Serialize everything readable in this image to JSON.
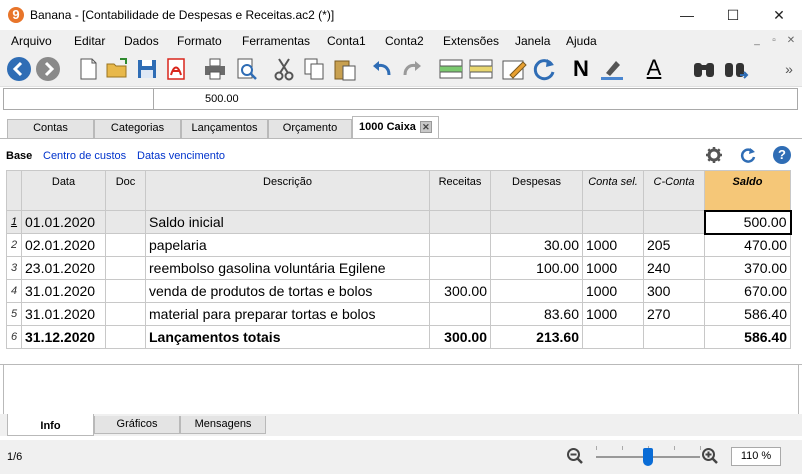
{
  "window": {
    "app_logo": "9",
    "title": "Banana - [Contabilidade de Despesas e Receitas.ac2 (*)]",
    "minimize_label": "—",
    "maximize_label": "☐",
    "close_label": "✕"
  },
  "menu": {
    "items": [
      "Arquivo",
      "Editar",
      "Dados",
      "Formato",
      "Ferramentas",
      "Conta1",
      "Conta2",
      "Extensões",
      "Janela",
      "Ajuda"
    ],
    "mdi": {
      "minimize": "_",
      "restore": "▫",
      "close": "✕"
    }
  },
  "toolbar": {
    "icons": [
      "back-icon",
      "forward-icon",
      "new-file-icon",
      "open-folder-icon",
      "save-icon",
      "pdf-icon",
      "print-icon",
      "print-preview-icon",
      "cut-icon",
      "copy-icon",
      "paste-icon",
      "undo-icon",
      "redo-icon",
      "add-row-icon",
      "insert-row-icon",
      "edit-icon",
      "recalculate-icon",
      "bold-icon",
      "highlighter-icon",
      "font-color-icon",
      "search-icon",
      "find-next-icon"
    ],
    "bold_glyph": "N",
    "font_color_glyph": "A",
    "overflow_glyph": "»",
    "colors": {
      "back_forward": "#2f6db5",
      "pdf": "#d9261c",
      "highlight_bar": "#4a86d0",
      "font_color_bar": "#000000"
    }
  },
  "formula_bar": {
    "value": "500.00"
  },
  "tabs": {
    "items": [
      "Contas",
      "Categorias",
      "Lançamentos",
      "Orçamento"
    ],
    "active": "1000 Caixa",
    "active_close": "✕"
  },
  "views": {
    "base": "Base",
    "links": [
      "Centro de custos",
      "Datas vencimento"
    ],
    "right_icons": [
      "gear-icon",
      "refresh-icon",
      "help-icon"
    ],
    "help_glyph": "?"
  },
  "table": {
    "columns": [
      "Data",
      "Doc",
      "Descrição",
      "Receitas",
      "Despesas",
      "Conta sel.",
      "C-Conta",
      "Saldo"
    ],
    "rows": [
      {
        "n": "1",
        "data": "01.01.2020",
        "doc": "",
        "desc": "Saldo inicial",
        "receitas": "",
        "despesas": "",
        "conta": "",
        "cconta": "",
        "saldo": "500.00"
      },
      {
        "n": "2",
        "data": "02.01.2020",
        "doc": "",
        "desc": "papelaria",
        "receitas": "",
        "despesas": "30.00",
        "conta": "1000",
        "cconta": "205",
        "saldo": "470.00"
      },
      {
        "n": "3",
        "data": "23.01.2020",
        "doc": "",
        "desc": "reembolso gasolina voluntária Egilene",
        "receitas": "",
        "despesas": "100.00",
        "conta": "1000",
        "cconta": "240",
        "saldo": "370.00"
      },
      {
        "n": "4",
        "data": "31.01.2020",
        "doc": "",
        "desc": "venda de produtos de tortas e bolos",
        "receitas": "300.00",
        "despesas": "",
        "conta": "1000",
        "cconta": "300",
        "saldo": "670.00"
      },
      {
        "n": "5",
        "data": "31.01.2020",
        "doc": "",
        "desc": "material para preparar tortas e bolos",
        "receitas": "",
        "despesas": "83.60",
        "conta": "1000",
        "cconta": "270",
        "saldo": "586.40"
      },
      {
        "n": "6",
        "data": "31.12.2020",
        "doc": "",
        "desc": "Lançamentos totais",
        "receitas": "300.00",
        "despesas": "213.60",
        "conta": "",
        "cconta": "",
        "saldo": "586.40"
      }
    ]
  },
  "bottom_tabs": {
    "items": [
      "Info",
      "Gráficos",
      "Mensagens"
    ],
    "active": "Info"
  },
  "status": {
    "page": "1/6",
    "zoom_out_glyph": "−",
    "zoom_in_glyph": "+",
    "zoom_value": "110 %",
    "zoom_level_fraction": 0.5
  }
}
